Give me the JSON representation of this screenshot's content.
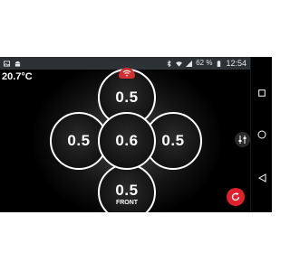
{
  "status_bar": {
    "battery_percent": "62 %",
    "time": "12:54",
    "icons": [
      "image-icon",
      "android-icon",
      "bluetooth-icon",
      "wifi-icon",
      "signal-icon",
      "battery-icon"
    ]
  },
  "temperature": "20.7°C",
  "zones": {
    "top": {
      "value": "0.5"
    },
    "left": {
      "value": "0.5"
    },
    "center": {
      "value": "0.6"
    },
    "right": {
      "value": "0.5"
    },
    "bottom": {
      "value": "0.5",
      "label": "FRONT"
    }
  },
  "controls": {
    "wifi_badge_icon": "wifi-icon",
    "equalizer_icon": "equalizer-icon",
    "reset_icon": "refresh-icon"
  },
  "nav_bar": {
    "icons": [
      "recents-square-icon",
      "home-circle-icon",
      "back-triangle-icon"
    ]
  },
  "colors": {
    "accent_red": "#d32f2f",
    "status_bar_bg": "#2c3135",
    "background": "#000000",
    "text": "#ffffff"
  }
}
